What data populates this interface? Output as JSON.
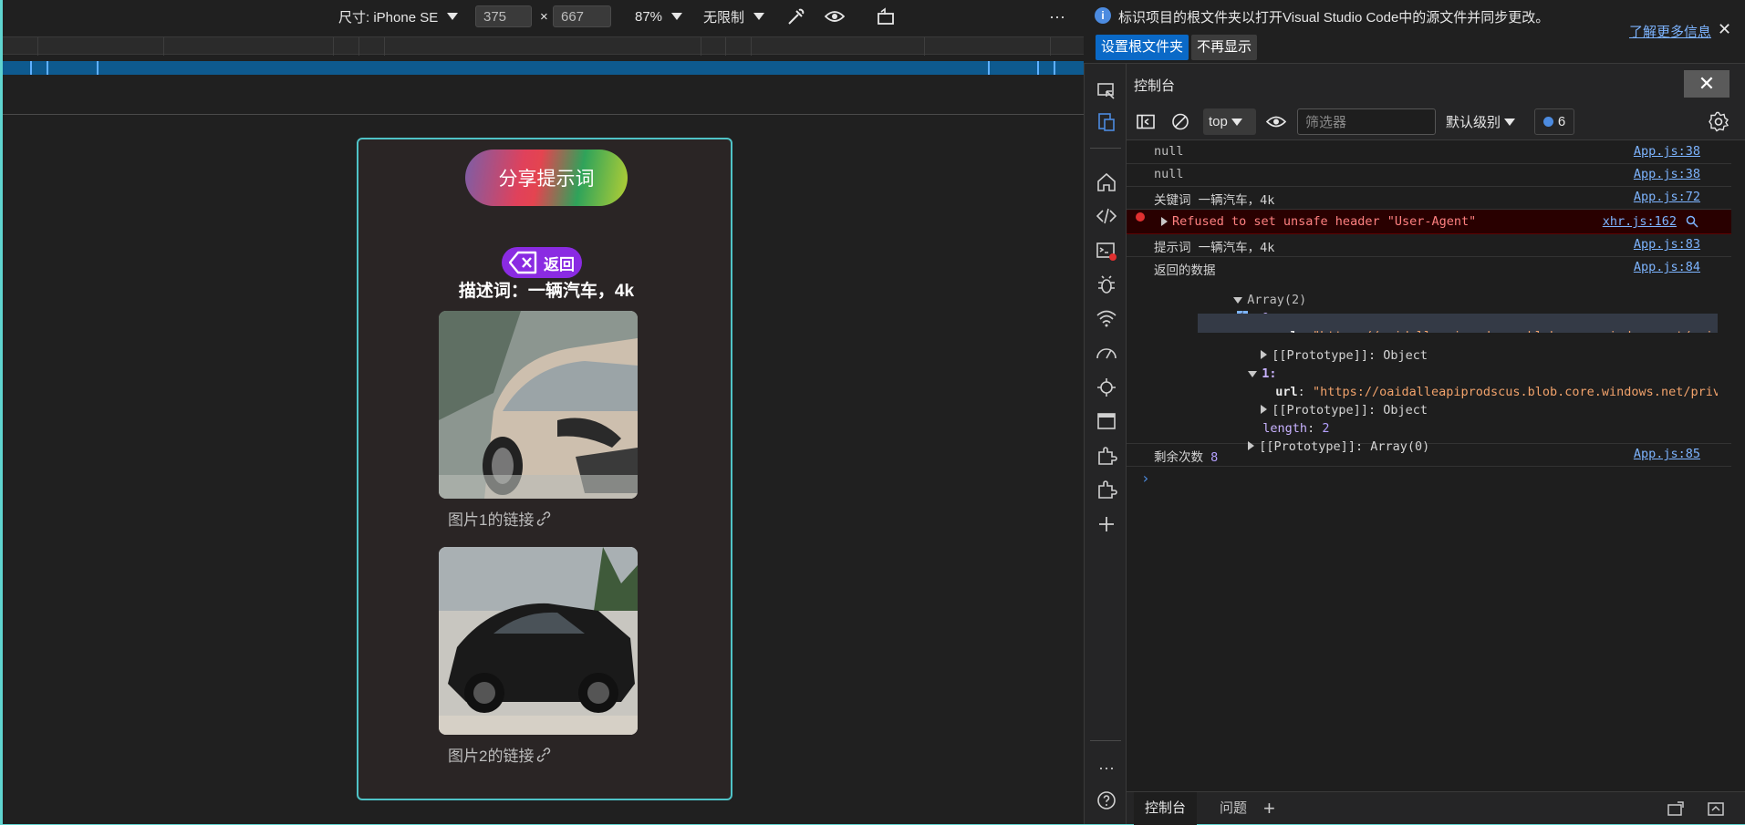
{
  "device_toolbar": {
    "size_label": "尺寸: iPhone SE",
    "width_value": "375",
    "times_sign": "×",
    "height_value": "667",
    "zoom_label": "87%",
    "throttle_label": "无限制",
    "more_label": "···"
  },
  "app": {
    "share_button": "分享提示词",
    "back_button": "返回",
    "description": "描述词：一辆汽车，4k",
    "image_links": [
      "图片1的链接",
      "图片2的链接"
    ]
  },
  "infobar": {
    "message": "标识项目的根文件夹以打开Visual Studio Code中的源文件并同步更改。",
    "learn_more": "了解更多信息",
    "set_root_button": "设置根文件夹",
    "dont_show_button": "不再显示"
  },
  "console": {
    "title": "控制台",
    "context": "top",
    "filter_placeholder": "筛选器",
    "level": "默认级别",
    "message_count": "6",
    "logs": [
      {
        "text": "null",
        "source": "App.js:38"
      },
      {
        "text": "null",
        "source": "App.js:38"
      },
      {
        "text": "关键词 一辆汽车，4k",
        "source": "App.js:72"
      },
      {
        "text": "Refused to set unsafe header \"User-Agent\"",
        "source": "xhr.js:162"
      },
      {
        "text": "提示词 一辆汽车，4k",
        "source": "App.js:83"
      },
      {
        "text": "返回的数据",
        "source": "App.js:84"
      },
      {
        "text": "剩余次数",
        "value": "8",
        "source": "App.js:85"
      }
    ],
    "tree": {
      "array_label": "Array(2)",
      "item0": "0:",
      "url_key": "url",
      "url_value": "\"https://oaidalleapiprodscus.blob.core.windows.net/private/org-",
      "proto_object": "[[Prototype]]: Object",
      "item1": "1:",
      "length_key": "length",
      "length_value": "2",
      "proto_array": "[[Prototype]]: Array(0)"
    },
    "bottom_tabs": [
      "控制台",
      "问题"
    ]
  }
}
